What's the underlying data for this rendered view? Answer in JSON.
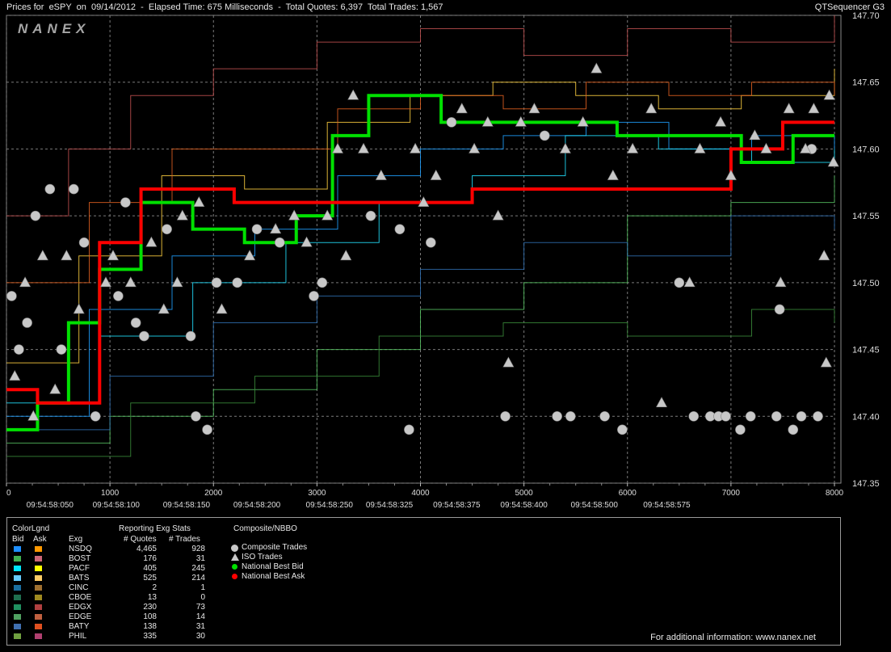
{
  "header": {
    "title_left": "Prices for  eSPY  on  09/14/2012  -  Elapsed Time: 675 Milliseconds  -  Total Quotes: 6,397  Total Trades: 1,567",
    "title_right": "QTSequencer G3"
  },
  "watermark": "NANEX",
  "colors": {
    "composite_trade": "#c8c8c8",
    "national_best_bid": "#00e000",
    "national_best_ask": "#ff0000",
    "grid": "#7a7a7a"
  },
  "chart_data": {
    "type": "line",
    "ylim": [
      147.35,
      147.7
    ],
    "xlim": [
      0,
      8000
    ],
    "y_ticks": [
      "147.35",
      "147.40",
      "147.45",
      "147.50",
      "147.55",
      "147.60",
      "147.65",
      "147.70"
    ],
    "x_ticks": [
      {
        "value": 0,
        "label": "0"
      },
      {
        "value": 1000,
        "label": "1000"
      },
      {
        "value": 2000,
        "label": "2000"
      },
      {
        "value": 3000,
        "label": "3000"
      },
      {
        "value": 4000,
        "label": "4000"
      },
      {
        "value": 5000,
        "label": "5000"
      },
      {
        "value": 6000,
        "label": "6000"
      },
      {
        "value": 7000,
        "label": "7000"
      },
      {
        "value": 8000,
        "label": "8000"
      }
    ],
    "time_labels": [
      {
        "value": 420,
        "label": "09:54:58:050"
      },
      {
        "value": 1060,
        "label": "09:54:58:100"
      },
      {
        "value": 1740,
        "label": "09:54:58:150"
      },
      {
        "value": 2420,
        "label": "09:54:58:200"
      },
      {
        "value": 3120,
        "label": "09:54:58:250"
      },
      {
        "value": 3700,
        "label": "09:54:58:325"
      },
      {
        "value": 4350,
        "label": "09:54:58:375"
      },
      {
        "value": 5000,
        "label": "09:54:58:400"
      },
      {
        "value": 5680,
        "label": "09:54:58:500"
      },
      {
        "value": 6380,
        "label": "09:54:58:575"
      }
    ],
    "national_best_bid": [
      {
        "x": 0,
        "y": 147.39
      },
      {
        "x": 300,
        "y": 147.41
      },
      {
        "x": 600,
        "y": 147.47
      },
      {
        "x": 900,
        "y": 147.51
      },
      {
        "x": 1300,
        "y": 147.56
      },
      {
        "x": 1800,
        "y": 147.54
      },
      {
        "x": 2300,
        "y": 147.53
      },
      {
        "x": 2800,
        "y": 147.55
      },
      {
        "x": 3150,
        "y": 147.61
      },
      {
        "x": 3500,
        "y": 147.64
      },
      {
        "x": 4200,
        "y": 147.62
      },
      {
        "x": 4800,
        "y": 147.62
      },
      {
        "x": 5300,
        "y": 147.62
      },
      {
        "x": 5900,
        "y": 147.61
      },
      {
        "x": 6500,
        "y": 147.61
      },
      {
        "x": 7100,
        "y": 147.59
      },
      {
        "x": 7600,
        "y": 147.61
      },
      {
        "x": 8000,
        "y": 147.61
      }
    ],
    "national_best_ask": [
      {
        "x": 0,
        "y": 147.42
      },
      {
        "x": 300,
        "y": 147.41
      },
      {
        "x": 900,
        "y": 147.53
      },
      {
        "x": 1300,
        "y": 147.57
      },
      {
        "x": 2200,
        "y": 147.56
      },
      {
        "x": 3300,
        "y": 147.56
      },
      {
        "x": 3900,
        "y": 147.56
      },
      {
        "x": 4500,
        "y": 147.57
      },
      {
        "x": 5500,
        "y": 147.57
      },
      {
        "x": 6500,
        "y": 147.57
      },
      {
        "x": 7000,
        "y": 147.6
      },
      {
        "x": 7500,
        "y": 147.62
      },
      {
        "x": 8000,
        "y": 147.62
      }
    ],
    "composite_trades": [
      {
        "x": 50,
        "y": 147.49
      },
      {
        "x": 120,
        "y": 147.45
      },
      {
        "x": 200,
        "y": 147.47
      },
      {
        "x": 280,
        "y": 147.55
      },
      {
        "x": 420,
        "y": 147.57
      },
      {
        "x": 530,
        "y": 147.45
      },
      {
        "x": 650,
        "y": 147.57
      },
      {
        "x": 750,
        "y": 147.53
      },
      {
        "x": 860,
        "y": 147.4
      },
      {
        "x": 1080,
        "y": 147.49
      },
      {
        "x": 1150,
        "y": 147.56
      },
      {
        "x": 1250,
        "y": 147.47
      },
      {
        "x": 1330,
        "y": 147.46
      },
      {
        "x": 1550,
        "y": 147.54
      },
      {
        "x": 1780,
        "y": 147.46
      },
      {
        "x": 1830,
        "y": 147.4
      },
      {
        "x": 1940,
        "y": 147.39
      },
      {
        "x": 2030,
        "y": 147.5
      },
      {
        "x": 2230,
        "y": 147.5
      },
      {
        "x": 2420,
        "y": 147.54
      },
      {
        "x": 2640,
        "y": 147.53
      },
      {
        "x": 2970,
        "y": 147.49
      },
      {
        "x": 3050,
        "y": 147.5
      },
      {
        "x": 3520,
        "y": 147.55
      },
      {
        "x": 3800,
        "y": 147.54
      },
      {
        "x": 3890,
        "y": 147.39
      },
      {
        "x": 4100,
        "y": 147.53
      },
      {
        "x": 4300,
        "y": 147.62
      },
      {
        "x": 4820,
        "y": 147.4
      },
      {
        "x": 5200,
        "y": 147.61
      },
      {
        "x": 5320,
        "y": 147.4
      },
      {
        "x": 5450,
        "y": 147.4
      },
      {
        "x": 5780,
        "y": 147.4
      },
      {
        "x": 5950,
        "y": 147.39
      },
      {
        "x": 6500,
        "y": 147.5
      },
      {
        "x": 6640,
        "y": 147.4
      },
      {
        "x": 6800,
        "y": 147.4
      },
      {
        "x": 6880,
        "y": 147.4
      },
      {
        "x": 6950,
        "y": 147.4
      },
      {
        "x": 7090,
        "y": 147.39
      },
      {
        "x": 7190,
        "y": 147.4
      },
      {
        "x": 7440,
        "y": 147.4
      },
      {
        "x": 7470,
        "y": 147.48
      },
      {
        "x": 7600,
        "y": 147.39
      },
      {
        "x": 7680,
        "y": 147.4
      },
      {
        "x": 7780,
        "y": 147.6
      },
      {
        "x": 7840,
        "y": 147.4
      }
    ],
    "iso_trades": [
      {
        "x": 80,
        "y": 147.43
      },
      {
        "x": 180,
        "y": 147.5
      },
      {
        "x": 260,
        "y": 147.4
      },
      {
        "x": 350,
        "y": 147.52
      },
      {
        "x": 470,
        "y": 147.42
      },
      {
        "x": 580,
        "y": 147.52
      },
      {
        "x": 700,
        "y": 147.48
      },
      {
        "x": 960,
        "y": 147.5
      },
      {
        "x": 1030,
        "y": 147.52
      },
      {
        "x": 1200,
        "y": 147.5
      },
      {
        "x": 1400,
        "y": 147.53
      },
      {
        "x": 1520,
        "y": 147.48
      },
      {
        "x": 1650,
        "y": 147.5
      },
      {
        "x": 1700,
        "y": 147.55
      },
      {
        "x": 1860,
        "y": 147.56
      },
      {
        "x": 2080,
        "y": 147.48
      },
      {
        "x": 2350,
        "y": 147.52
      },
      {
        "x": 2600,
        "y": 147.54
      },
      {
        "x": 2780,
        "y": 147.55
      },
      {
        "x": 2900,
        "y": 147.53
      },
      {
        "x": 3100,
        "y": 147.55
      },
      {
        "x": 3200,
        "y": 147.6
      },
      {
        "x": 3280,
        "y": 147.52
      },
      {
        "x": 3350,
        "y": 147.64
      },
      {
        "x": 3450,
        "y": 147.6
      },
      {
        "x": 3620,
        "y": 147.58
      },
      {
        "x": 3950,
        "y": 147.6
      },
      {
        "x": 4030,
        "y": 147.56
      },
      {
        "x": 4150,
        "y": 147.58
      },
      {
        "x": 4400,
        "y": 147.63
      },
      {
        "x": 4520,
        "y": 147.6
      },
      {
        "x": 4650,
        "y": 147.62
      },
      {
        "x": 4750,
        "y": 147.55
      },
      {
        "x": 4850,
        "y": 147.44
      },
      {
        "x": 4970,
        "y": 147.62
      },
      {
        "x": 5100,
        "y": 147.63
      },
      {
        "x": 5400,
        "y": 147.6
      },
      {
        "x": 5570,
        "y": 147.62
      },
      {
        "x": 5700,
        "y": 147.66
      },
      {
        "x": 5860,
        "y": 147.58
      },
      {
        "x": 6050,
        "y": 147.6
      },
      {
        "x": 6230,
        "y": 147.63
      },
      {
        "x": 6330,
        "y": 147.41
      },
      {
        "x": 6600,
        "y": 147.5
      },
      {
        "x": 6700,
        "y": 147.6
      },
      {
        "x": 6900,
        "y": 147.62
      },
      {
        "x": 7000,
        "y": 147.58
      },
      {
        "x": 7230,
        "y": 147.61
      },
      {
        "x": 7340,
        "y": 147.6
      },
      {
        "x": 7480,
        "y": 147.5
      },
      {
        "x": 7560,
        "y": 147.63
      },
      {
        "x": 7720,
        "y": 147.6
      },
      {
        "x": 7800,
        "y": 147.63
      },
      {
        "x": 7900,
        "y": 147.52
      },
      {
        "x": 7920,
        "y": 147.44
      },
      {
        "x": 7950,
        "y": 147.64
      },
      {
        "x": 7990,
        "y": 147.59
      }
    ],
    "exchange_quote_lines": [
      {
        "name": "NSDQ",
        "color": "#1fa0ff",
        "points": [
          [
            0,
            147.4
          ],
          [
            800,
            147.48
          ],
          [
            1600,
            147.52
          ],
          [
            2400,
            147.54
          ],
          [
            3200,
            147.58
          ],
          [
            4000,
            147.6
          ],
          [
            4800,
            147.61
          ],
          [
            5600,
            147.62
          ],
          [
            6400,
            147.6
          ],
          [
            7200,
            147.61
          ],
          [
            8000,
            147.6
          ]
        ]
      },
      {
        "name": "BOST",
        "color": "#55c060",
        "points": [
          [
            0,
            147.38
          ],
          [
            1000,
            147.4
          ],
          [
            2000,
            147.42
          ],
          [
            3000,
            147.45
          ],
          [
            4000,
            147.48
          ],
          [
            5000,
            147.5
          ],
          [
            6000,
            147.55
          ],
          [
            7000,
            147.56
          ],
          [
            8000,
            147.58
          ]
        ]
      },
      {
        "name": "PACF",
        "color": "#22e0ff",
        "points": [
          [
            0,
            147.41
          ],
          [
            900,
            147.46
          ],
          [
            1800,
            147.5
          ],
          [
            2700,
            147.53
          ],
          [
            3600,
            147.56
          ],
          [
            4500,
            147.58
          ],
          [
            5400,
            147.61
          ],
          [
            6300,
            147.6
          ],
          [
            7200,
            147.59
          ],
          [
            8000,
            147.6
          ]
        ]
      },
      {
        "name": "BATS",
        "color": "#ffd040",
        "points": [
          [
            0,
            147.44
          ],
          [
            700,
            147.52
          ],
          [
            1500,
            147.58
          ],
          [
            2300,
            147.57
          ],
          [
            3100,
            147.62
          ],
          [
            3900,
            147.64
          ],
          [
            4700,
            147.65
          ],
          [
            5500,
            147.64
          ],
          [
            6300,
            147.63
          ],
          [
            7100,
            147.64
          ],
          [
            8000,
            147.66
          ]
        ]
      },
      {
        "name": "EDGX",
        "color": "#c05050",
        "points": [
          [
            0,
            147.55
          ],
          [
            600,
            147.6
          ],
          [
            1200,
            147.64
          ],
          [
            2000,
            147.66
          ],
          [
            3000,
            147.68
          ],
          [
            4000,
            147.69
          ],
          [
            5000,
            147.67
          ],
          [
            6000,
            147.69
          ],
          [
            7000,
            147.68
          ],
          [
            8000,
            147.7
          ]
        ]
      },
      {
        "name": "EDGE",
        "color": "#3a8a3a",
        "points": [
          [
            0,
            147.37
          ],
          [
            1200,
            147.41
          ],
          [
            2400,
            147.43
          ],
          [
            3600,
            147.46
          ],
          [
            4800,
            147.47
          ],
          [
            6000,
            147.46
          ],
          [
            7200,
            147.48
          ],
          [
            8000,
            147.47
          ]
        ]
      },
      {
        "name": "BATY",
        "color": "#e06020",
        "points": [
          [
            0,
            147.5
          ],
          [
            800,
            147.56
          ],
          [
            1600,
            147.6
          ],
          [
            2400,
            147.6
          ],
          [
            3200,
            147.63
          ],
          [
            4000,
            147.64
          ],
          [
            4800,
            147.63
          ],
          [
            5600,
            147.65
          ],
          [
            6400,
            147.64
          ],
          [
            7200,
            147.65
          ],
          [
            8000,
            147.64
          ]
        ]
      },
      {
        "name": "PHIL",
        "color": "#2f6fb0",
        "points": [
          [
            0,
            147.39
          ],
          [
            1000,
            147.43
          ],
          [
            2000,
            147.47
          ],
          [
            3000,
            147.49
          ],
          [
            4000,
            147.51
          ],
          [
            5000,
            147.53
          ],
          [
            6000,
            147.52
          ],
          [
            7000,
            147.55
          ],
          [
            8000,
            147.54
          ]
        ]
      }
    ]
  },
  "legend": {
    "color_legend_title": "ColorLgnd",
    "bid_header": "Bid",
    "ask_header": "Ask",
    "exg_header": "Exg",
    "stats_title": "Reporting Exg Stats",
    "quotes_header": "# Quotes",
    "trades_header": "# Trades",
    "composite_title": "Composite/NBBO",
    "composite_items": {
      "composite_trades": "Composite Trades",
      "iso_trades": "ISO Trades",
      "national_best_bid": "National Best Bid",
      "national_best_ask": "National Best Ask"
    },
    "exchanges": [
      {
        "name": "NSDQ",
        "quotes": "4,465",
        "trades": "928",
        "bid_color": "#1e90ff",
        "ask_color": "#ff9900"
      },
      {
        "name": "BOST",
        "quotes": "176",
        "trades": "31",
        "bid_color": "#40b050",
        "ask_color": "#cc6677"
      },
      {
        "name": "PACF",
        "quotes": "405",
        "trades": "245",
        "bid_color": "#00e5ff",
        "ask_color": "#ffff00"
      },
      {
        "name": "BATS",
        "quotes": "525",
        "trades": "214",
        "bid_color": "#66ccff",
        "ask_color": "#ffcc66"
      },
      {
        "name": "CINC",
        "quotes": "2",
        "trades": "1",
        "bid_color": "#1a6fa0",
        "ask_color": "#a07030"
      },
      {
        "name": "CBOE",
        "quotes": "13",
        "trades": "0",
        "bid_color": "#1f6f4f",
        "ask_color": "#a08a20"
      },
      {
        "name": "EDGX",
        "quotes": "230",
        "trades": "73",
        "bid_color": "#209060",
        "ask_color": "#b04040"
      },
      {
        "name": "EDGE",
        "quotes": "108",
        "trades": "14",
        "bid_color": "#50a060",
        "ask_color": "#c06040"
      },
      {
        "name": "BATY",
        "quotes": "138",
        "trades": "31",
        "bid_color": "#4070b0",
        "ask_color": "#e05020"
      },
      {
        "name": "PHIL",
        "quotes": "335",
        "trades": "30",
        "bid_color": "#70a040",
        "ask_color": "#b04070"
      }
    ],
    "footer": "For additional information: www.nanex.net"
  }
}
